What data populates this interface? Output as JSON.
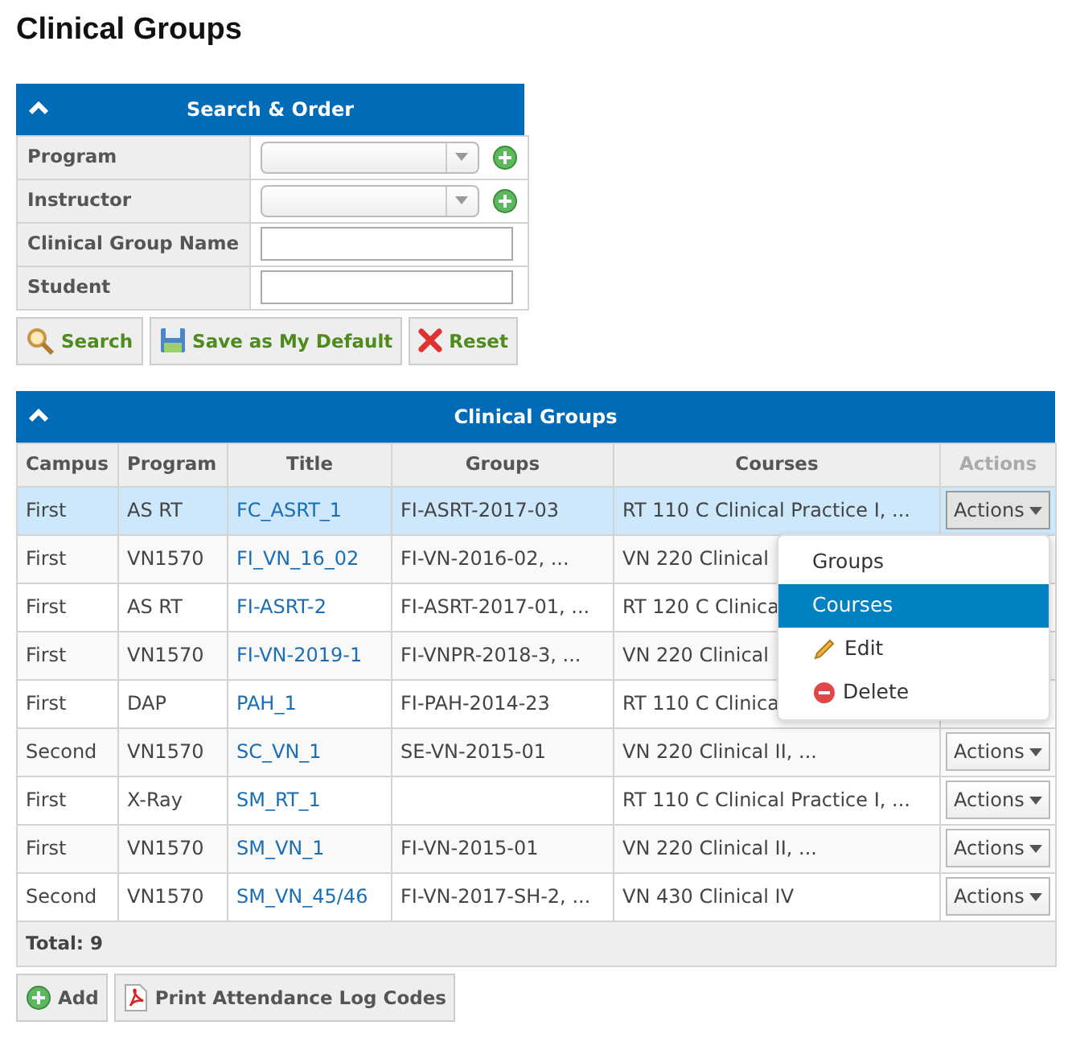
{
  "page_title": "Clinical Groups",
  "search_panel": {
    "title": "Search & Order",
    "fields": [
      {
        "label": "Program",
        "kind": "select"
      },
      {
        "label": "Instructor",
        "kind": "select"
      },
      {
        "label": "Clinical Group Name",
        "kind": "text"
      },
      {
        "label": "Student",
        "kind": "text"
      }
    ],
    "buttons": [
      {
        "label": "Search",
        "kind": "search"
      },
      {
        "label": "Save as My Default",
        "kind": "save"
      },
      {
        "label": "Reset",
        "kind": "reset"
      }
    ]
  },
  "groups_panel": {
    "title": "Clinical Groups",
    "columns": [
      "Campus",
      "Program",
      "Title",
      "Groups",
      "Courses",
      "Actions"
    ],
    "rows": [
      {
        "campus": "First",
        "program": "AS RT",
        "title": "FC_ASRT_1",
        "groups": "FI-ASRT-2017-03",
        "courses": "RT 110 C Clinical Practice I, ...",
        "actions": "Actions",
        "selected": true,
        "menu_open": true
      },
      {
        "campus": "First",
        "program": "VN1570",
        "title": "FI_VN_16_02",
        "groups": "FI-VN-2016-02, ...",
        "courses": "VN 220 Clinical",
        "selected": false,
        "menu_open": false
      },
      {
        "campus": "First",
        "program": "AS RT",
        "title": "FI-ASRT-2",
        "groups": "FI-ASRT-2017-01, ...",
        "courses": "RT 120 C Clinica",
        "selected": false,
        "menu_open": false
      },
      {
        "campus": "First",
        "program": "VN1570",
        "title": "FI-VN-2019-1",
        "groups": "FI-VNPR-2018-3, ...",
        "courses": "VN 220 Clinical",
        "selected": false,
        "menu_open": false
      },
      {
        "campus": "First",
        "program": "DAP",
        "title": "PAH_1",
        "groups": "FI-PAH-2014-23",
        "courses": "RT 110 C Clinica",
        "selected": false,
        "menu_open": false
      },
      {
        "campus": "Second",
        "program": "VN1570",
        "title": "SC_VN_1",
        "groups": "SE-VN-2015-01",
        "courses": "VN 220 Clinical II, ...",
        "actions": "Actions",
        "selected": false,
        "menu_open": false
      },
      {
        "campus": "First",
        "program": "X-Ray",
        "title": "SM_RT_1",
        "groups": "",
        "courses": "RT 110 C Clinical Practice I, ...",
        "actions": "Actions",
        "selected": false,
        "menu_open": false
      },
      {
        "campus": "First",
        "program": "VN1570",
        "title": "SM_VN_1",
        "groups": "FI-VN-2015-01",
        "courses": "VN 220 Clinical II, ...",
        "actions": "Actions",
        "selected": false,
        "menu_open": false
      },
      {
        "campus": "Second",
        "program": "VN1570",
        "title": "SM_VN_45/46",
        "groups": "FI-VN-2017-SH-2, ...",
        "courses": "VN 430 Clinical IV",
        "actions": "Actions",
        "selected": false,
        "menu_open": false
      }
    ],
    "total": "Total: 9",
    "menu": [
      {
        "label": "Groups",
        "kind": "plain",
        "selected": false
      },
      {
        "label": "Courses",
        "kind": "plain",
        "selected": true
      },
      {
        "label": "Edit",
        "kind": "edit",
        "selected": false
      },
      {
        "label": "Delete",
        "kind": "delete",
        "selected": false
      }
    ],
    "buttons": [
      {
        "label": "Add",
        "kind": "add"
      },
      {
        "label": "Print Attendance Log Codes",
        "kind": "pdf"
      }
    ]
  }
}
